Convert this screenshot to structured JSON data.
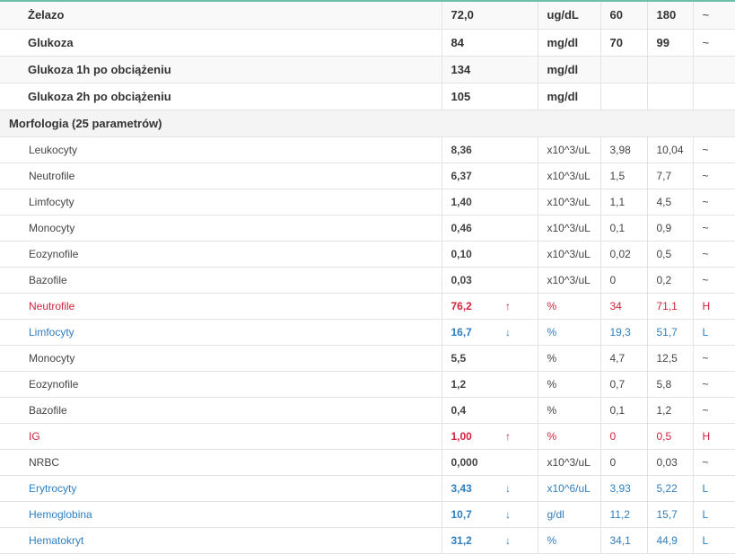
{
  "colors": {
    "high": "#d0243c",
    "low": "#2f7fc0",
    "accent_line": "#6dc0a8"
  },
  "top_tests": [
    {
      "name": "Żelazo",
      "value": "72,0",
      "unit": "ug/dL",
      "min": "60",
      "max": "180",
      "flag": "~"
    },
    {
      "name": "Glukoza",
      "value": "84",
      "unit": "mg/dl",
      "min": "70",
      "max": "99",
      "flag": "~"
    },
    {
      "name": "Glukoza 1h po obciążeniu",
      "value": "134",
      "unit": "mg/dl",
      "min": "",
      "max": "",
      "flag": ""
    },
    {
      "name": "Glukoza 2h po obciążeniu",
      "value": "105",
      "unit": "mg/dl",
      "min": "",
      "max": "",
      "flag": ""
    }
  ],
  "section": {
    "title": "Morfologia (25 parametrów)"
  },
  "morphology": [
    {
      "name": "Leukocyty",
      "value": "8,36",
      "arrow": "",
      "unit": "x10^3/uL",
      "min": "3,98",
      "max": "10,04",
      "flag": "~",
      "status": "normal"
    },
    {
      "name": "Neutrofile",
      "value": "6,37",
      "arrow": "",
      "unit": "x10^3/uL",
      "min": "1,5",
      "max": "7,7",
      "flag": "~",
      "status": "normal"
    },
    {
      "name": "Limfocyty",
      "value": "1,40",
      "arrow": "",
      "unit": "x10^3/uL",
      "min": "1,1",
      "max": "4,5",
      "flag": "~",
      "status": "normal"
    },
    {
      "name": "Monocyty",
      "value": "0,46",
      "arrow": "",
      "unit": "x10^3/uL",
      "min": "0,1",
      "max": "0,9",
      "flag": "~",
      "status": "normal"
    },
    {
      "name": "Eozynofile",
      "value": "0,10",
      "arrow": "",
      "unit": "x10^3/uL",
      "min": "0,02",
      "max": "0,5",
      "flag": "~",
      "status": "normal"
    },
    {
      "name": "Bazofile",
      "value": "0,03",
      "arrow": "",
      "unit": "x10^3/uL",
      "min": "0",
      "max": "0,2",
      "flag": "~",
      "status": "normal"
    },
    {
      "name": "Neutrofile",
      "value": "76,2",
      "arrow": "↑",
      "unit": "%",
      "min": "34",
      "max": "71,1",
      "flag": "H",
      "status": "high"
    },
    {
      "name": "Limfocyty",
      "value": "16,7",
      "arrow": "↓",
      "unit": "%",
      "min": "19,3",
      "max": "51,7",
      "flag": "L",
      "status": "low"
    },
    {
      "name": "Monocyty",
      "value": "5,5",
      "arrow": "",
      "unit": "%",
      "min": "4,7",
      "max": "12,5",
      "flag": "~",
      "status": "normal"
    },
    {
      "name": "Eozynofile",
      "value": "1,2",
      "arrow": "",
      "unit": "%",
      "min": "0,7",
      "max": "5,8",
      "flag": "~",
      "status": "normal"
    },
    {
      "name": "Bazofile",
      "value": "0,4",
      "arrow": "",
      "unit": "%",
      "min": "0,1",
      "max": "1,2",
      "flag": "~",
      "status": "normal"
    },
    {
      "name": "IG",
      "value": "1,00",
      "arrow": "↑",
      "unit": "%",
      "min": "0",
      "max": "0,5",
      "flag": "H",
      "status": "high"
    },
    {
      "name": "NRBC",
      "value": "0,000",
      "arrow": "",
      "unit": "x10^3/uL",
      "min": "0",
      "max": "0,03",
      "flag": "~",
      "status": "normal"
    },
    {
      "name": "Erytrocyty",
      "value": "3,43",
      "arrow": "↓",
      "unit": "x10^6/uL",
      "min": "3,93",
      "max": "5,22",
      "flag": "L",
      "status": "low"
    },
    {
      "name": "Hemoglobina",
      "value": "10,7",
      "arrow": "↓",
      "unit": "g/dl",
      "min": "11,2",
      "max": "15,7",
      "flag": "L",
      "status": "low"
    },
    {
      "name": "Hematokryt",
      "value": "31,2",
      "arrow": "↓",
      "unit": "%",
      "min": "34,1",
      "max": "44,9",
      "flag": "L",
      "status": "low"
    }
  ]
}
